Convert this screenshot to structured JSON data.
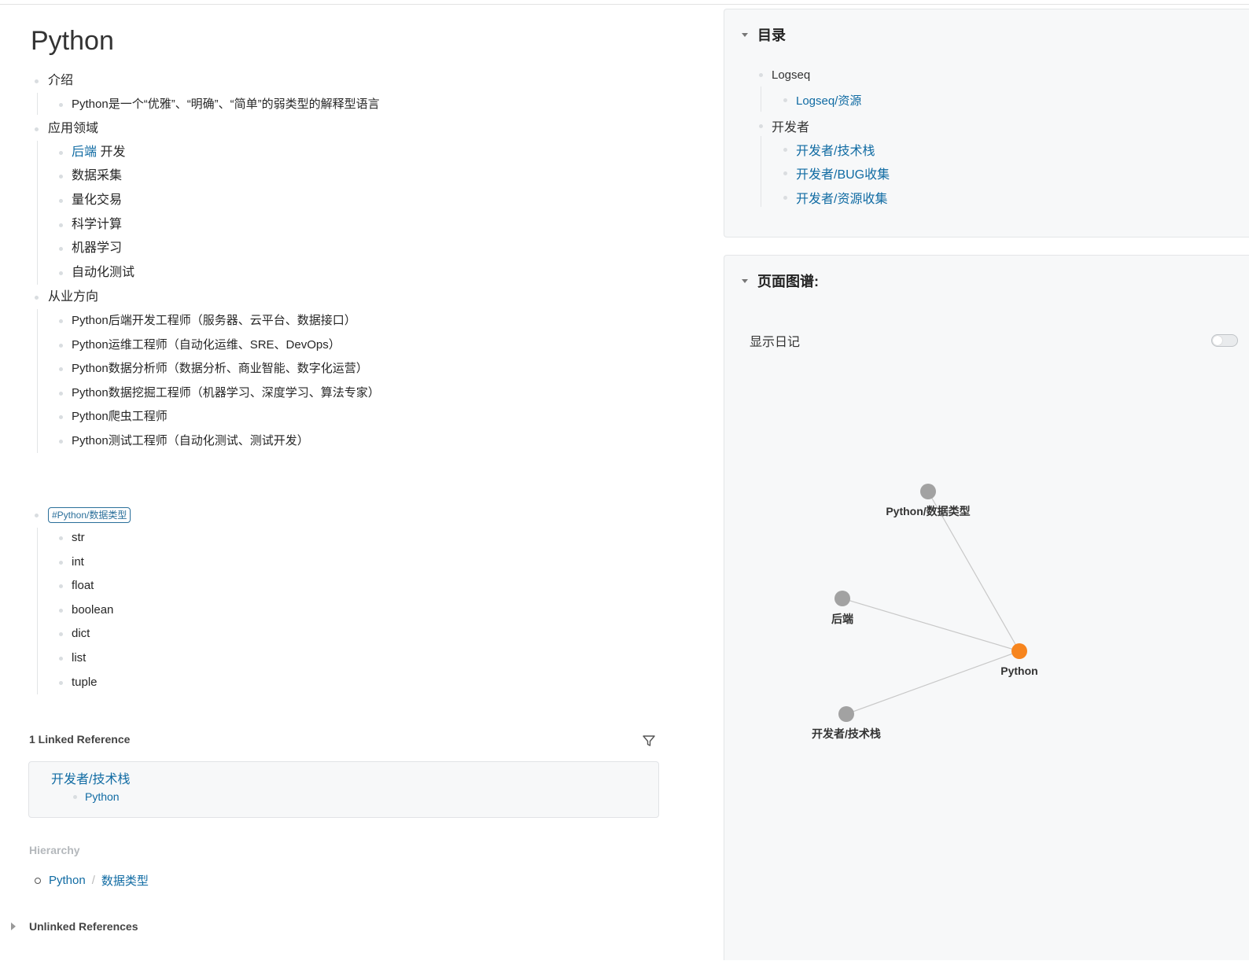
{
  "page": {
    "title": "Python",
    "blocks": {
      "intro": "介绍",
      "intro_child": "Python是一个“优雅”、“明确”、“简单”的弱类型的解释型语言",
      "domains": "应用领域",
      "domain_items": {
        "backend_link": "后端",
        "backend_rest": " 开发",
        "d2": "数据采集",
        "d3": "量化交易",
        "d4": "科学计算",
        "d5": "机器学习",
        "d6": "自动化测试"
      },
      "careers": "从业方向",
      "career_items": [
        "Python后端开发工程师（服务器、云平台、数据接口）",
        "Python运维工程师（自动化运维、SRE、DevOps）",
        "Python数据分析师（数据分析、商业智能、数字化运营）",
        "Python数据挖掘工程师（机器学习、深度学习、算法专家）",
        "Python爬虫工程师",
        "Python测试工程师（自动化测试、测试开发）"
      ],
      "tag": "#Python/数据类型",
      "types": [
        "str",
        "int",
        "float",
        "boolean",
        "dict",
        "list",
        "tuple"
      ]
    }
  },
  "linked_refs": {
    "title": "1 Linked Reference",
    "page": "开发者/技术栈",
    "child": "Python"
  },
  "hierarchy": {
    "title": "Hierarchy",
    "parent": "Python",
    "separator": "/",
    "child": "数据类型"
  },
  "unlinked_refs": {
    "title": "Unlinked References"
  },
  "toc": {
    "title": "目录",
    "items": {
      "logseq": "Logseq",
      "logseq_res": "Logseq/资源",
      "dev": "开发者",
      "dev_stack": "开发者/技术栈",
      "dev_bug": "开发者/BUG收集",
      "dev_res": "开发者/资源收集"
    }
  },
  "page_graph": {
    "title": "页面图谱:",
    "show_journals_label": "显示日记",
    "show_journals": false,
    "colors": {
      "current": "#f7851e",
      "node": "#a2a2a2",
      "edge": "#c8c8c8"
    },
    "nodes": {
      "data_types": "Python/数据类型",
      "backend": "后端",
      "python": "Python",
      "dev_stack": "开发者/技术栈"
    },
    "edges": [
      [
        "data_types",
        "python"
      ],
      [
        "backend",
        "python"
      ],
      [
        "dev_stack",
        "python"
      ]
    ]
  }
}
